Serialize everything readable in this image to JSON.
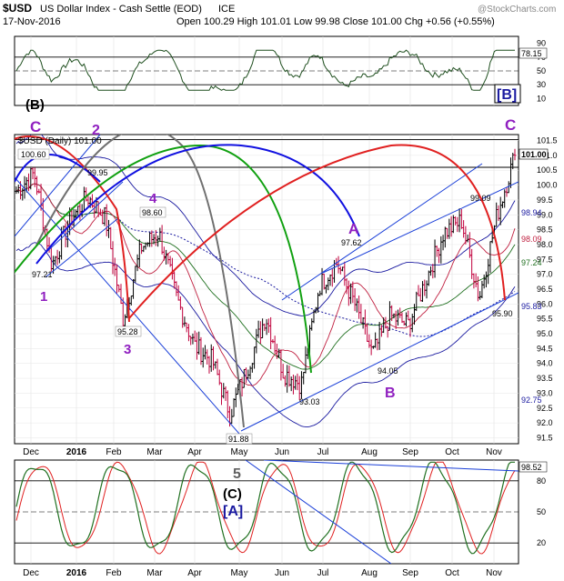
{
  "header": {
    "symbol": "$USD",
    "name": "US Dollar Index - Cash Settle (EOD)",
    "exchange": "ICE",
    "date": "17-Nov-2016",
    "ohlc": "Open 100.29  High 101.01  Low 99.98  Close 101.00  Chg +0.56 (+0.55%)",
    "copyright": "@StockCharts.com",
    "legend": "$USD (Daily) 101.00"
  },
  "colors": {
    "price_bar": "#000000",
    "down_bar": "#c0003c",
    "rsi_line": "#1f4f1f",
    "ma_dotted": "#1a1aa0",
    "ma_red": "#c02040",
    "ma_green": "#207020",
    "bollinger": "#1a1aa0",
    "trendline": "#1a3fd8",
    "arc_red": "#e02020",
    "arc_blue": "#1010e0",
    "arc_green": "#10a010",
    "arc_gray": "#707070",
    "wave_purple": "#9020c0",
    "stoch_red": "#e02020",
    "stoch_green": "#207020"
  },
  "waves": {
    "c_top_left": "C",
    "b_paren": "(B)",
    "two": "2",
    "one": "1",
    "three": "3",
    "four": "4",
    "a_mid": "A",
    "b_mid": "B",
    "bracket_b": "[B]",
    "c_right": "C",
    "five": "5",
    "c_paren": "(C)",
    "bracket_a": "[A]"
  },
  "price_labels": {
    "p100_60": "100.60",
    "p99_95": "99.95",
    "p98_60": "98.60",
    "p97_21": "97.21",
    "p95_28": "95.28",
    "p97_62": "97.62",
    "p94_05": "94.05",
    "p93_03": "93.03",
    "p91_88": "91.88",
    "p99_09": "99.09",
    "p95_90": "95.90"
  },
  "right_tags": {
    "rsi_last": "78.15",
    "price_last": "101.00",
    "bb_upper": "98.94",
    "ma_red": "98.09",
    "ma_green": "97.24",
    "bb_mid": "95.83",
    "bb_lower": "92.75",
    "stoch_last": "98.52"
  },
  "chart_data": {
    "type": "candlestick",
    "title": "$USD US Dollar Index - Cash Settle (EOD) ICE",
    "x_ticks": [
      "Dec",
      "2016",
      "Feb",
      "Mar",
      "Apr",
      "May",
      "Jun",
      "Jul",
      "Aug",
      "Sep",
      "Oct",
      "Nov"
    ],
    "price_axis": {
      "ticks": [
        "101.5",
        "101.0",
        "100.5",
        "100.0",
        "99.5",
        "99.0",
        "98.5",
        "98.0",
        "97.5",
        "97.0",
        "96.5",
        "96.0",
        "95.5",
        "95.0",
        "94.5",
        "94.0",
        "93.5",
        "93.0",
        "92.5",
        "92.0",
        "91.5"
      ],
      "range": [
        91.3,
        101.7
      ]
    },
    "rsi_axis": {
      "ticks": [
        "90",
        "70",
        "50",
        "30",
        "10"
      ],
      "range": [
        0,
        100
      ]
    },
    "stoch_axis": {
      "ticks": [
        "80",
        "50",
        "20"
      ],
      "range": [
        0,
        100
      ]
    },
    "pivots": [
      {
        "label": "100.60",
        "date": "Dec 2015",
        "value": 100.6
      },
      {
        "label": "97.21",
        "date": "Dec 2015",
        "value": 97.21
      },
      {
        "label": "99.95",
        "date": "Jan 2016",
        "value": 99.95
      },
      {
        "label": "95.28",
        "date": "Feb 2016",
        "value": 95.28
      },
      {
        "label": "98.60",
        "date": "Mar 2016",
        "value": 98.6
      },
      {
        "label": "91.88",
        "date": "May 2016",
        "value": 91.88
      },
      {
        "label": "97.62",
        "date": "Jul 2016",
        "value": 97.62
      },
      {
        "label": "93.03",
        "date": "Jun 2016",
        "value": 93.03
      },
      {
        "label": "94.05",
        "date": "Aug 2016",
        "value": 94.05
      },
      {
        "label": "99.09",
        "date": "Oct 2016",
        "value": 99.09
      },
      {
        "label": "95.90",
        "date": "Nov 2016",
        "value": 95.9
      },
      {
        "label": "101.00",
        "date": "17-Nov-2016",
        "value": 101.0
      }
    ],
    "close_path": [
      [
        "Nov 2015",
        99.8
      ],
      [
        "Dec 2015",
        100.4
      ],
      [
        "Dec 2015",
        97.3
      ],
      [
        "Jan 2016",
        98.8
      ],
      [
        "Jan 2016",
        99.6
      ],
      [
        "Feb 2016",
        98.9
      ],
      [
        "Feb 2016",
        95.5
      ],
      [
        "Mar 2016",
        97.9
      ],
      [
        "Mar 2016",
        98.4
      ],
      [
        "Mar 2016",
        96.2
      ],
      [
        "Apr 2016",
        94.6
      ],
      [
        "Apr 2016",
        94.1
      ],
      [
        "May 2016",
        92.3
      ],
      [
        "May 2016",
        93.9
      ],
      [
        "Jun 2016",
        95.6
      ],
      [
        "Jun 2016",
        93.7
      ],
      [
        "Jun 2016",
        93.3
      ],
      [
        "Jul 2016",
        96.6
      ],
      [
        "Jul 2016",
        97.4
      ],
      [
        "Aug 2016",
        96.0
      ],
      [
        "Aug 2016",
        94.3
      ],
      [
        "Sep 2016",
        95.6
      ],
      [
        "Sep 2016",
        95.3
      ],
      [
        "Oct 2016",
        96.8
      ],
      [
        "Oct 2016",
        98.4
      ],
      [
        "Oct 2016",
        98.8
      ],
      [
        "Nov 2016",
        96.2
      ],
      [
        "Nov 2016",
        99.0
      ],
      [
        "17-Nov-2016",
        101.0
      ]
    ]
  }
}
